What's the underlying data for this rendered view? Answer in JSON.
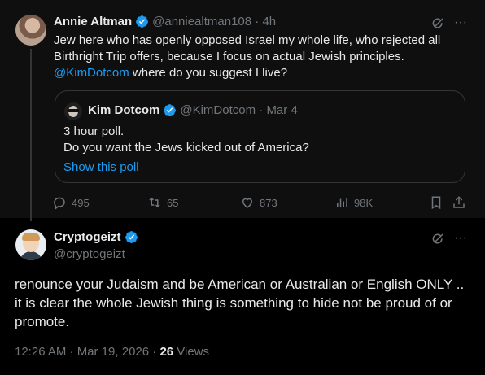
{
  "post": {
    "author_name": "Annie Altman",
    "author_handle": "@anniealtman108",
    "time_ago": "4h",
    "text_lines": [
      "Jew here who has openly opposed Israel my whole life, who rejected all",
      "Birthright Trip offers, because I focus on actual Jewish principles."
    ],
    "mention": "@KimDotcom",
    "text_end": " where do you suggest I live?",
    "quote": {
      "author_name": "Kim Dotcom",
      "author_handle": "@KimDotcom",
      "date": "Mar 4",
      "line1": "3 hour poll.",
      "line2": "Do you want the Jews kicked out of America?",
      "show_poll": "Show this poll"
    },
    "actions": {
      "replies": "495",
      "reposts": "65",
      "likes": "873",
      "views": "98K"
    }
  },
  "reply": {
    "author_name": "Cryptogeizt",
    "author_handle": "@cryptogeizt",
    "text": "renounce your Judaism and be American or Australian or English ONLY .. it is clear the whole Jewish thing is something to hide not be proud of or promote.",
    "timestamp": "12:26 AM · Mar 19, 2026 · ",
    "views_count": "26",
    "views_label": " Views"
  },
  "colors": {
    "accent": "#1d9bf0",
    "muted": "#71767b",
    "text": "#e7e9ea"
  }
}
